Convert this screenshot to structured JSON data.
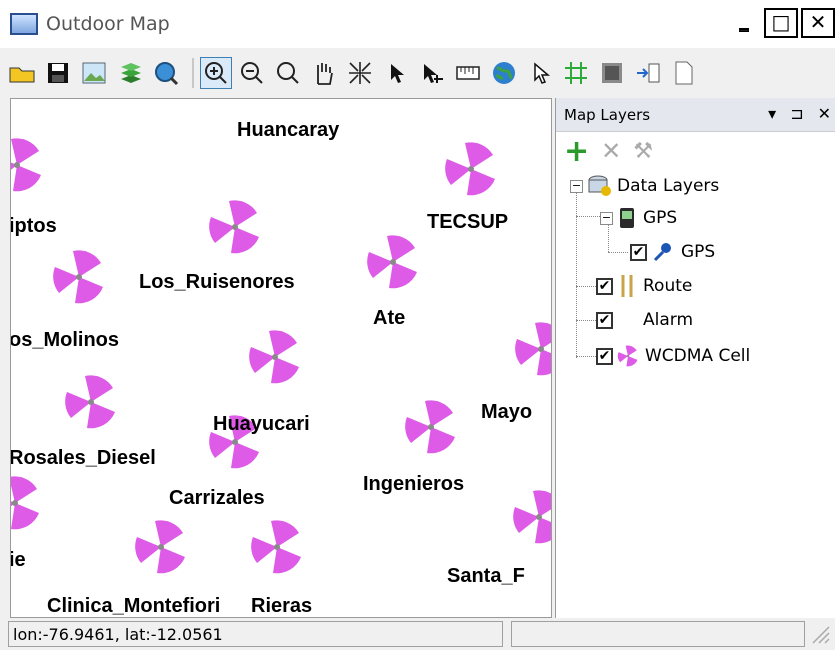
{
  "window": {
    "title": "Outdoor Map",
    "min_label": "_",
    "max_label": "□",
    "close_label": "✕"
  },
  "toolbar": {
    "buttons": [
      {
        "name": "open-folder-icon"
      },
      {
        "name": "save-icon"
      },
      {
        "name": "image-icon"
      },
      {
        "name": "layers-icon"
      },
      {
        "name": "globe-search-icon"
      },
      {
        "name": "zoom-in-icon",
        "active": true
      },
      {
        "name": "zoom-out-icon"
      },
      {
        "name": "zoom-rect-icon"
      },
      {
        "name": "pan-hand-icon"
      },
      {
        "name": "full-extent-icon"
      },
      {
        "name": "select-arrow-icon"
      },
      {
        "name": "select-plus-icon"
      },
      {
        "name": "ruler-icon"
      },
      {
        "name": "globe-icon"
      },
      {
        "name": "pointer-icon"
      },
      {
        "name": "grid-icon"
      },
      {
        "name": "texture-icon"
      },
      {
        "name": "import-icon"
      },
      {
        "name": "document-icon"
      }
    ]
  },
  "map": {
    "labels": {
      "huancaray": "Huancaray",
      "iptos": "iptos",
      "tecsup": "TECSUP",
      "los_ruisenores": "Los_Ruisenores",
      "ate": "Ate",
      "os_molinos": "os_Molinos",
      "mayo": "Mayo",
      "huayucari": "Huayucari",
      "rosales_diesel": "Rosales_Diesel",
      "ingenieros": "Ingenieros",
      "carrizales": "Carrizales",
      "ie": "ie",
      "santa_f": "Santa_F",
      "clinica_montefiori": "Clinica_Montefiori",
      "rieras": "Rieras"
    },
    "cell_color": "#dd5be6"
  },
  "layers_panel": {
    "title": "Map Layers",
    "pin_label": "▾",
    "pin_icon": "⊐",
    "close_label": "✕",
    "tools": {
      "add": "+",
      "remove": "✕",
      "settings": "⚒"
    },
    "tree": {
      "root": "Data Layers",
      "gps_group": "GPS",
      "gps_layer": "GPS",
      "route": "Route",
      "alarm": "Alarm",
      "wcdma": "WCDMA Cell"
    },
    "checked": "✔"
  },
  "status": {
    "coords": "lon:-76.9461, lat:-12.0561"
  }
}
